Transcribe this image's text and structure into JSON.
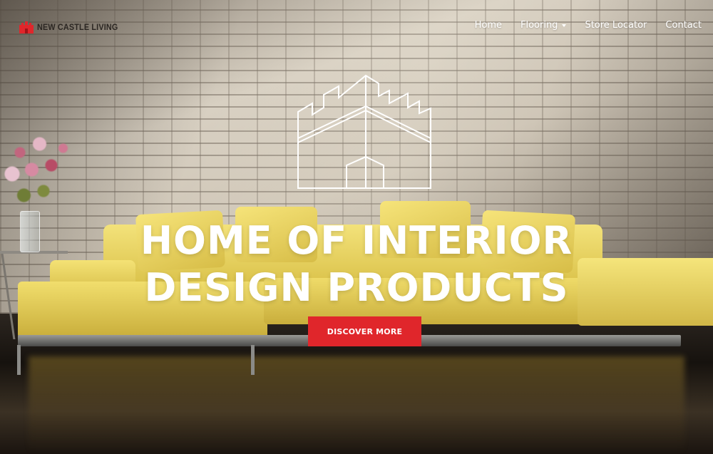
{
  "header": {
    "logo_text": "NEW CASTLE LIVING",
    "logo_icon": "castle-icon",
    "nav": [
      {
        "label": "Home"
      },
      {
        "label": "Flooring",
        "has_dropdown": true
      },
      {
        "label": "Store Locator"
      },
      {
        "label": "Contact"
      }
    ]
  },
  "hero": {
    "emblem_icon": "castle-outline-icon",
    "headline_line1": "HOME OF INTERIOR",
    "headline_line2": "DESIGN PRODUCTS",
    "cta_label": "DISCOVER MORE"
  },
  "colors": {
    "brand_red": "#e0262b",
    "nav_text": "#ffffff",
    "logo_text": "#2b2622"
  }
}
